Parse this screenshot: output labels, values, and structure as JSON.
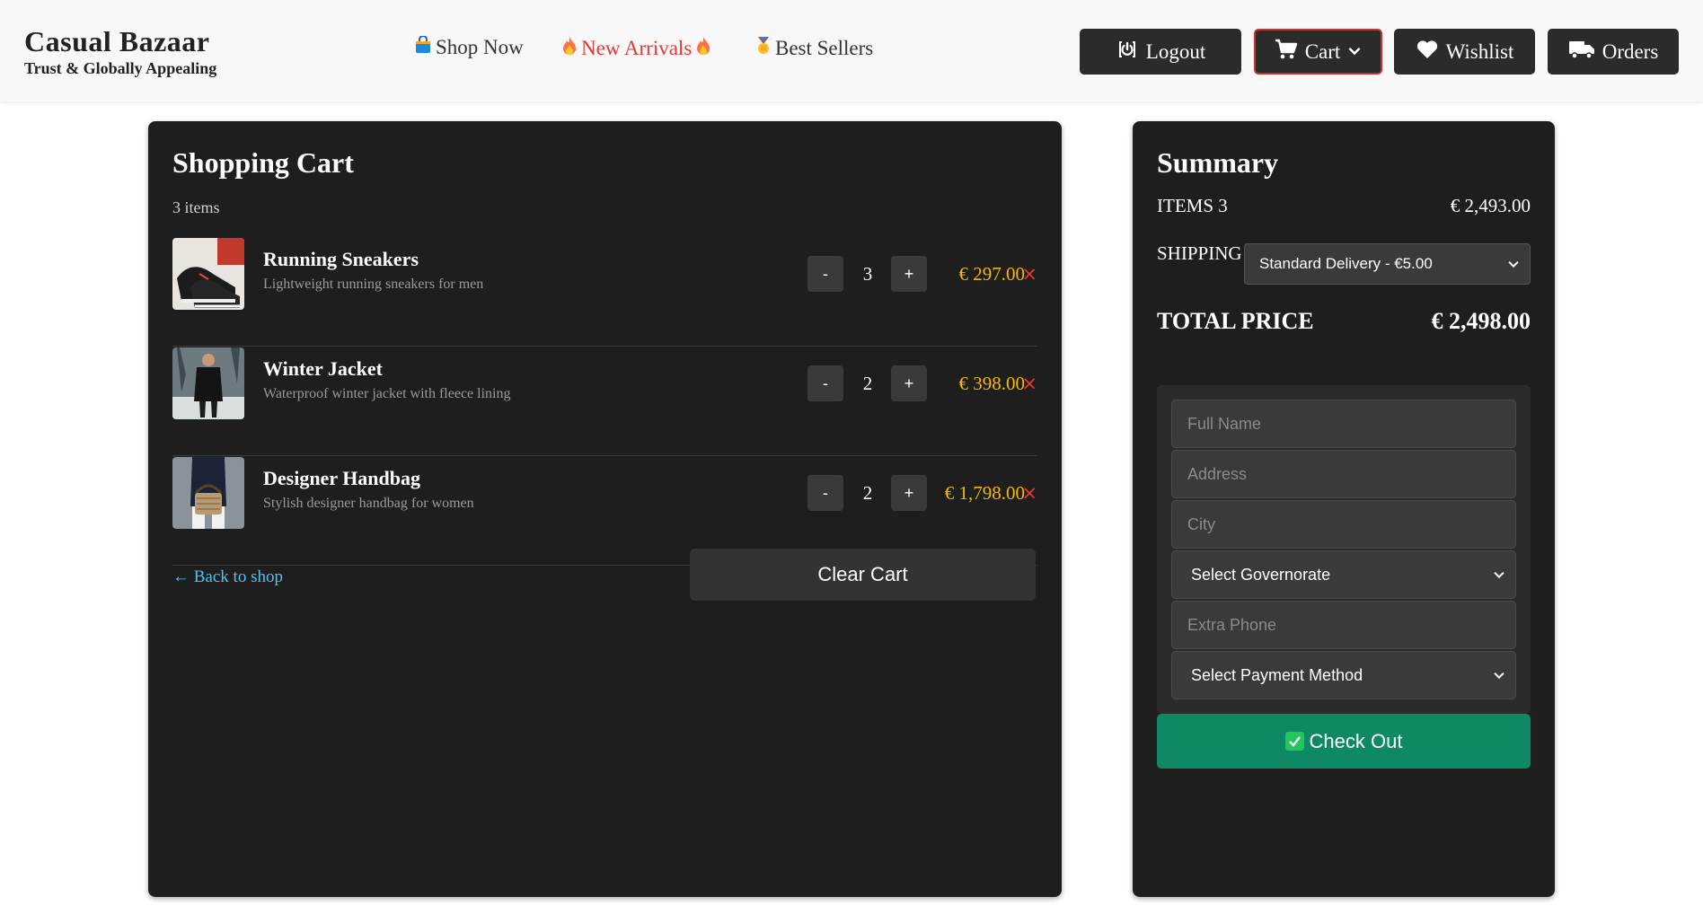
{
  "brand": {
    "name": "Casual Bazaar",
    "tagline": "Trust & Globally Appealing"
  },
  "nav": {
    "shop_now": "Shop Now",
    "new_arrivals": "New Arrivals",
    "best_sellers": "Best Sellers"
  },
  "header_buttons": {
    "logout": "Logout",
    "cart": "Cart",
    "wishlist": "Wishlist",
    "orders": "Orders"
  },
  "colors": {
    "accent_red": "#e53935",
    "price_gold": "#f5b800",
    "checkout_green": "#0d8a63",
    "link_blue": "#4fc3f7"
  },
  "cart": {
    "title": "Shopping Cart",
    "items_count": "3 items",
    "items": [
      {
        "name": "Running Sneakers",
        "description": "Lightweight running sneakers for men",
        "quantity": "3",
        "price": "€ 297.00"
      },
      {
        "name": "Winter Jacket",
        "description": "Waterproof winter jacket with fleece lining",
        "quantity": "2",
        "price": "€ 398.00"
      },
      {
        "name": "Designer Handbag",
        "description": "Stylish designer handbag for women",
        "quantity": "2",
        "price": "€ 1,798.00"
      }
    ],
    "minus_label": "-",
    "plus_label": "+",
    "remove_label": "×",
    "back_to_shop": "← Back to shop",
    "clear_cart": "Clear Cart"
  },
  "summary": {
    "title": "Summary",
    "items_label": "ITEMS 3",
    "items_total": "€ 2,493.00",
    "shipping_label": "SHIPPING",
    "shipping_selected": "Standard Delivery - €5.00",
    "total_label": "TOTAL PRICE",
    "total_value": "€ 2,498.00",
    "form": {
      "full_name_placeholder": "Full Name",
      "address_placeholder": "Address",
      "city_placeholder": "City",
      "governorate_selected": "Select Governorate",
      "extra_phone_placeholder": "Extra Phone",
      "payment_selected": "Select Payment Method"
    },
    "checkout": "Check Out"
  }
}
